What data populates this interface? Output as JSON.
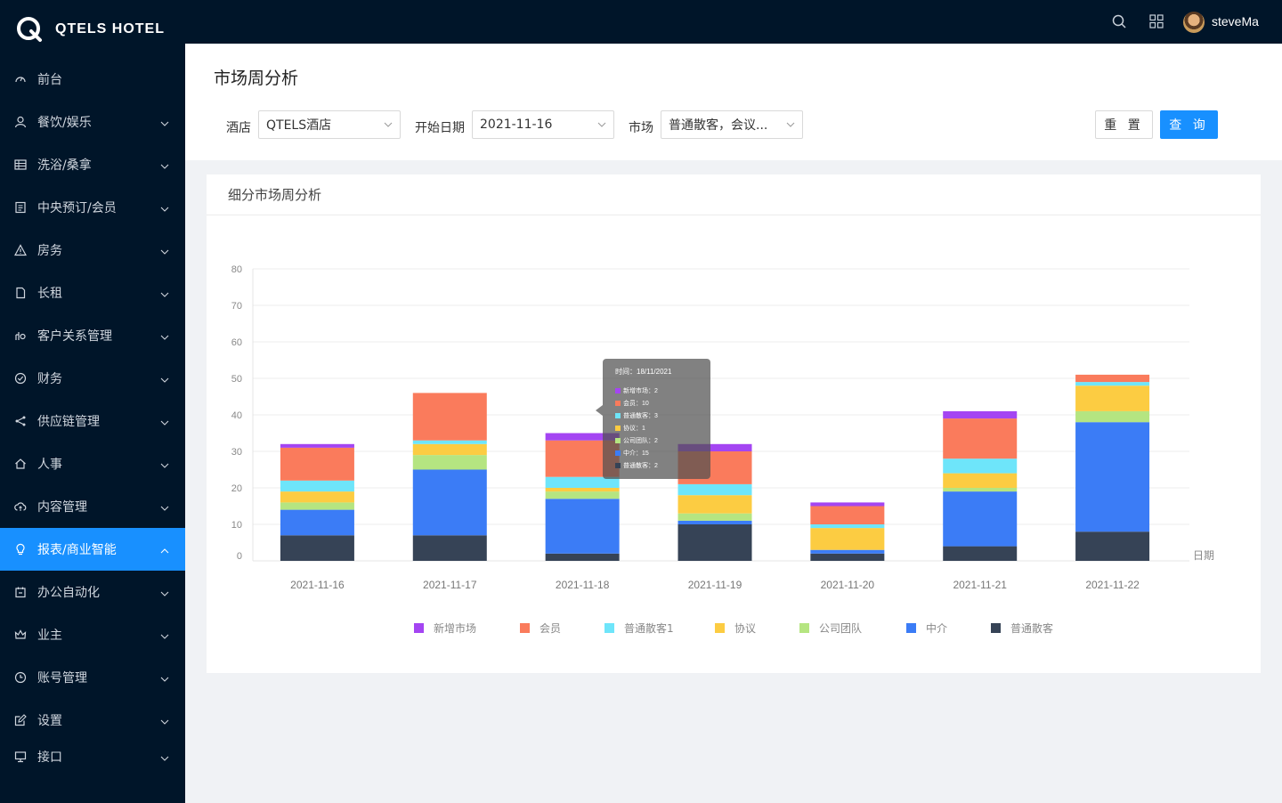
{
  "app": {
    "brand": "QTELS HOTEL",
    "username": "steveMa"
  },
  "sidebar": {
    "items": [
      {
        "label": "前台",
        "icon": "dashboard-icon",
        "expandable": false,
        "active": false
      },
      {
        "label": "餐饮/娱乐",
        "icon": "user-icon",
        "expandable": true,
        "active": false
      },
      {
        "label": "洗浴/桑拿",
        "icon": "table-icon",
        "expandable": true,
        "active": false
      },
      {
        "label": "中央预订/会员",
        "icon": "form-icon",
        "expandable": true,
        "active": false
      },
      {
        "label": "房务",
        "icon": "warning-icon",
        "expandable": true,
        "active": false
      },
      {
        "label": "长租",
        "icon": "file-icon",
        "expandable": true,
        "active": false
      },
      {
        "label": "客户关系管理",
        "icon": "contacts-icon",
        "expandable": true,
        "active": false
      },
      {
        "label": "财务",
        "icon": "check-circle-icon",
        "expandable": true,
        "active": false
      },
      {
        "label": "供应链管理",
        "icon": "share-icon",
        "expandable": true,
        "active": false
      },
      {
        "label": "人事",
        "icon": "home-icon",
        "expandable": true,
        "active": false
      },
      {
        "label": "内容管理",
        "icon": "cloud-icon",
        "expandable": true,
        "active": false
      },
      {
        "label": "报表/商业智能",
        "icon": "bulb-icon",
        "expandable": true,
        "active": true
      },
      {
        "label": "办公自动化",
        "icon": "calendar-icon",
        "expandable": true,
        "active": false
      },
      {
        "label": "业主",
        "icon": "crown-icon",
        "expandable": true,
        "active": false
      },
      {
        "label": "账号管理",
        "icon": "clock-icon",
        "expandable": true,
        "active": false
      },
      {
        "label": "设置",
        "icon": "edit-icon",
        "expandable": true,
        "active": false
      },
      {
        "label": "接口",
        "icon": "desktop-icon",
        "expandable": true,
        "active": false
      }
    ]
  },
  "page": {
    "title": "市场周分析"
  },
  "filters": {
    "hotel_label": "酒店",
    "hotel_value": "QTELS酒店",
    "date_label": "开始日期",
    "date_value": "2021-11-16",
    "market_label": "市场",
    "market_value": "普通散客，会议..."
  },
  "buttons": {
    "reset": "重 置",
    "query": "查 询"
  },
  "card": {
    "title": "细分市场周分析"
  },
  "colors": {
    "新增市场": "#a445f2",
    "会员": "#fa7b5c",
    "普通散客1": "#6ee5fa",
    "协议": "#fccc42",
    "公司团队": "#b5e581",
    "中介": "#3b7cf6",
    "普通散客": "#364356"
  },
  "chart_data": {
    "type": "bar",
    "stacked": true,
    "categories": [
      "2021-11-16",
      "2021-11-17",
      "2021-11-18",
      "2021-11-19",
      "2021-11-20",
      "2021-11-21",
      "2021-11-22"
    ],
    "series": [
      {
        "name": "普通散客",
        "values": [
          7,
          7,
          2,
          10,
          2,
          4,
          8
        ]
      },
      {
        "name": "中介",
        "values": [
          7,
          18,
          15,
          1,
          1,
          15,
          30
        ]
      },
      {
        "name": "公司团队",
        "values": [
          2,
          4,
          2,
          2,
          0,
          1,
          3
        ]
      },
      {
        "name": "协议",
        "values": [
          3,
          3,
          1,
          5,
          6,
          4,
          7
        ]
      },
      {
        "name": "普通散客1",
        "values": [
          3,
          1,
          3,
          3,
          1,
          4,
          1
        ]
      },
      {
        "name": "会员",
        "values": [
          9,
          13,
          10,
          9,
          5,
          11,
          2
        ]
      },
      {
        "name": "新增市场",
        "values": [
          1,
          0,
          2,
          2,
          1,
          2,
          0
        ]
      }
    ],
    "xlabel": "日期",
    "ylabel": "",
    "ylim": [
      0,
      80
    ],
    "yticks": [
      0,
      10,
      20,
      30,
      40,
      50,
      60,
      70,
      80
    ],
    "legend_position": "bottom",
    "legend_order": [
      "新增市场",
      "会员",
      "普通散客1",
      "协议",
      "公司团队",
      "中介",
      "普通散客"
    ],
    "grid": true
  },
  "tooltip": {
    "title": "时间：18/11/2021",
    "rows": [
      {
        "label": "新增市场：2",
        "series": "新增市场"
      },
      {
        "label": "会员：10",
        "series": "会员"
      },
      {
        "label": "普通散客：3",
        "series": "普通散客1"
      },
      {
        "label": "协议：1",
        "series": "协议"
      },
      {
        "label": "公司团队：2",
        "series": "公司团队"
      },
      {
        "label": "中介：15",
        "series": "中介"
      },
      {
        "label": "普通散客：2",
        "series": "普通散客"
      }
    ]
  }
}
